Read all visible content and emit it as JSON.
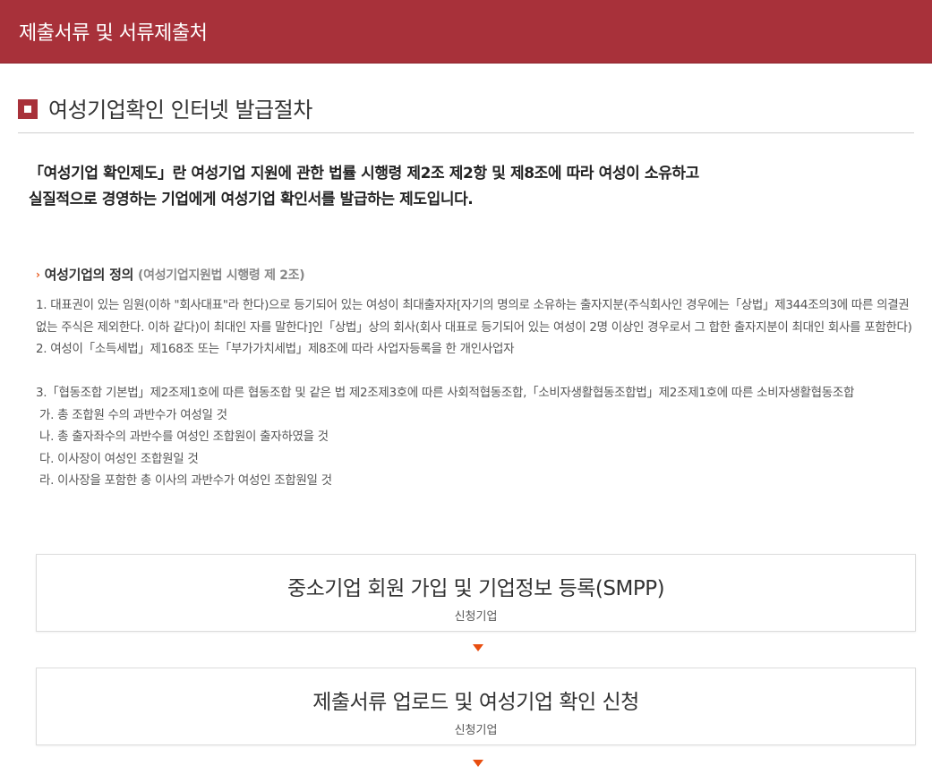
{
  "header": {
    "title": "제출서류 및 서류제출처"
  },
  "section": {
    "title": "여성기업확인 인터넷 발급절차"
  },
  "intro": {
    "line1": "「여성기업 확인제도」란 여성기업 지원에 관한 법률 시행령 제2조 제2항 및 제8조에 따라 여성이 소유하고",
    "line2": "실질적으로 경영하는 기업에게 여성기업 확인서를 발급하는 제도입니다."
  },
  "definition": {
    "title": "여성기업의 정의",
    "subtitle": "(여성기업지원법 시행령 제 2조)",
    "items": [
      "1. 대표권이 있는 임원(이하 \"회사대표\"라 한다)으로 등기되어 있는 여성이 최대출자자[자기의 명의로 소유하는 출자지분(주식회사인 경우에는「상법」제344조의3에 따른 의결권 없는 주식은 제외한다. 이하 같다)이 최대인 자를 말한다]인「상법」상의 회사(회사 대표로 등기되어 있는 여성이 2명 이상인 경우로서 그 합한 출자지분이 최대인 회사를 포함한다)",
      "2. 여성이「소득세법」제168조 또는「부가가치세법」제8조에 따라 사업자등록을 한 개인사업자",
      "3.「협동조합 기본법」제2조제1호에 따른 협동조합 및 같은 법 제2조제3호에 따른 사회적협동조합,「소비자생활협동조합법」제2조제1호에 따른 소비자생활협동조합"
    ],
    "subitems": [
      " 가. 총 조합원 수의 과반수가 여성일 것",
      " 나. 총 출자좌수의 과반수를 여성인 조합원이 출자하였을 것",
      " 다. 이사장이 여성인 조합원일 것",
      " 라. 이사장을 포함한 총 이사의 과반수가 여성인 조합원일 것"
    ]
  },
  "steps": [
    {
      "name": "중소기업 회원 가입 및 기업정보 등록(SMPP)",
      "who": "신청기업"
    },
    {
      "name": "제출서류 업로드 및 여성기업 확인 신청",
      "who": "신청기업"
    }
  ],
  "colors": {
    "brand": "#a8313a",
    "arrow": "#e84e10"
  }
}
